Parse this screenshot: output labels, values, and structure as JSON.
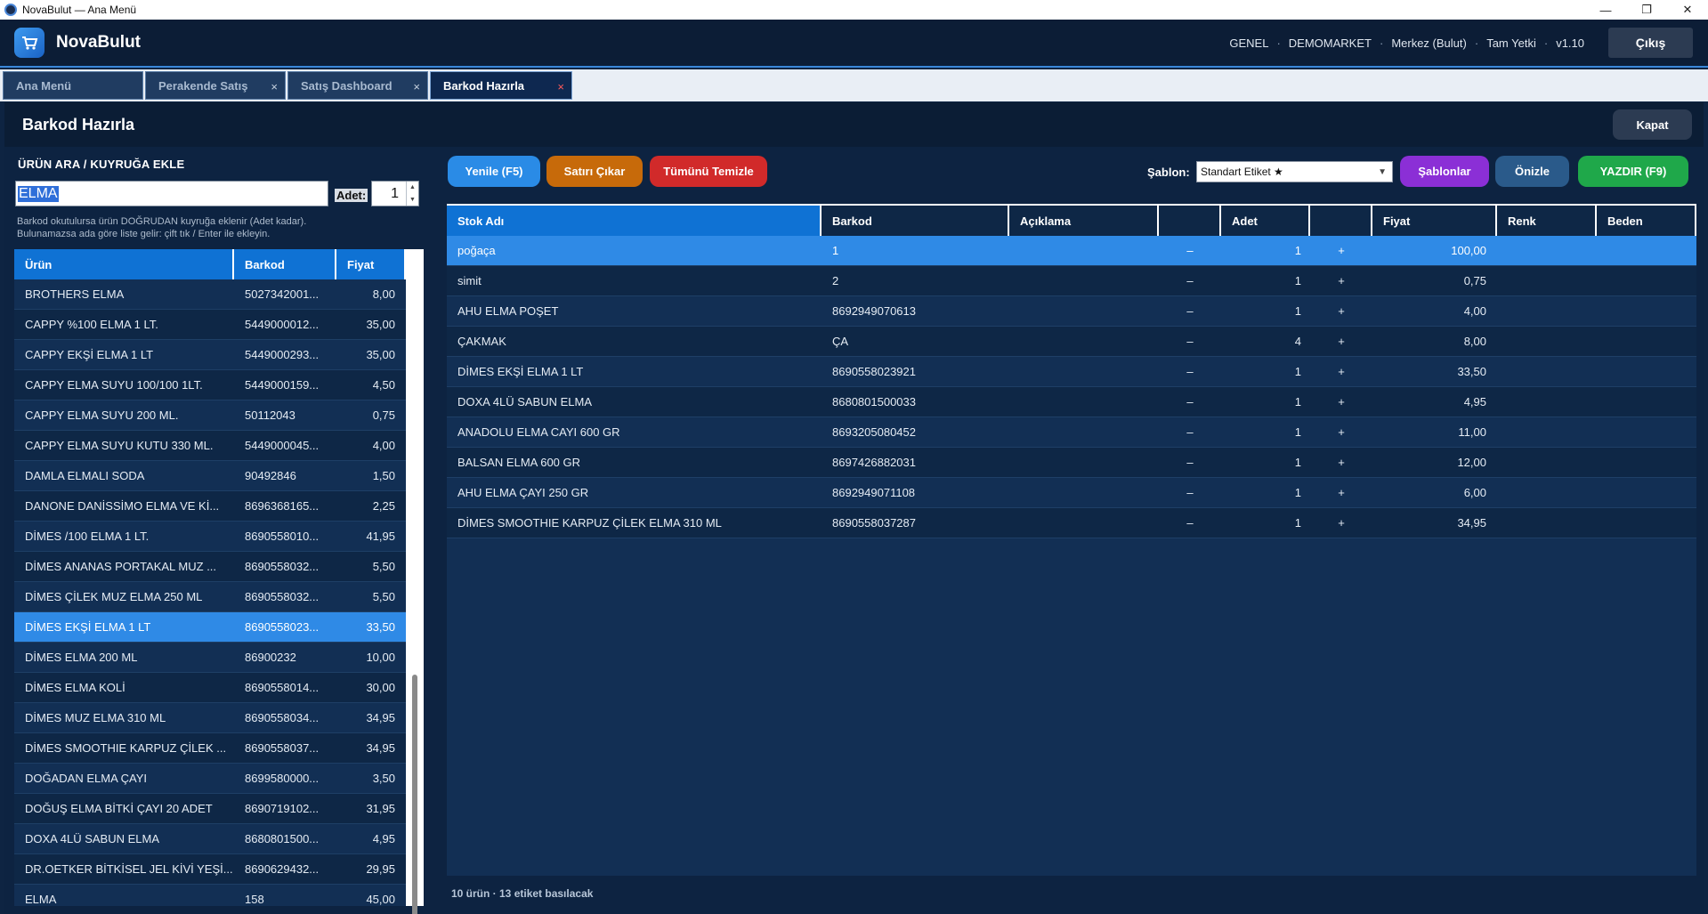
{
  "window": {
    "title": "NovaBulut — Ana Menü",
    "minimize": "—",
    "maximize": "❐",
    "close": "✕"
  },
  "header": {
    "brand": "NovaBulut",
    "info": [
      "GENEL",
      "DEMOMARKET",
      "Merkez (Bulut)",
      "Tam Yetki",
      "v1.10"
    ],
    "separator": "·",
    "logout": "Çıkış"
  },
  "tabs": [
    {
      "label": "Ana Menü",
      "closable": false
    },
    {
      "label": "Perakende Satış",
      "closable": true
    },
    {
      "label": "Satış Dashboard",
      "closable": true
    },
    {
      "label": "Barkod Hazırla",
      "closable": true,
      "active": true
    }
  ],
  "tab_close_glyph": "×",
  "page": {
    "title": "Barkod Hazırla",
    "close_button": "Kapat"
  },
  "search": {
    "heading": "ÜRÜN ARA / KUYRUĞA EKLE",
    "value": "ELMA",
    "qty_label": "Adet:",
    "qty_value": "1",
    "hint_line1": "Barkod okutulursa ürün DOĞRUDAN kuyruğa eklenir (Adet kadar).",
    "hint_line2": "Bulunamazsa ada göre liste gelir: çift tık / Enter ile ekleyin."
  },
  "product_list": {
    "columns": [
      "Ürün",
      "Barkod",
      "Fiyat"
    ],
    "selected_index": 11,
    "rows": [
      [
        "BROTHERS ELMA",
        "5027342001...",
        "8,00"
      ],
      [
        "CAPPY %100 ELMA 1 LT.",
        "5449000012...",
        "35,00"
      ],
      [
        "CAPPY EKŞİ ELMA 1 LT",
        "5449000293...",
        "35,00"
      ],
      [
        "CAPPY ELMA SUYU 100/100 1LT.",
        "5449000159...",
        "4,50"
      ],
      [
        "CAPPY ELMA SUYU 200 ML.",
        "50112043",
        "0,75"
      ],
      [
        "CAPPY ELMA SUYU KUTU 330 ML.",
        "5449000045...",
        "4,00"
      ],
      [
        "DAMLA ELMALI SODA",
        "90492846",
        "1,50"
      ],
      [
        "DANONE DANİSSİMO ELMA VE Kİ...",
        "8696368165...",
        "2,25"
      ],
      [
        "DİMES /100 ELMA 1 LT.",
        "8690558010...",
        "41,95"
      ],
      [
        "DİMES ANANAS PORTAKAL MUZ ...",
        "8690558032...",
        "5,50"
      ],
      [
        "DİMES ÇİLEK MUZ ELMA 250 ML",
        "8690558032...",
        "5,50"
      ],
      [
        "DİMES EKŞİ ELMA 1 LT",
        "8690558023...",
        "33,50"
      ],
      [
        "DİMES ELMA 200 ML",
        "86900232",
        "10,00"
      ],
      [
        "DİMES ELMA KOLİ",
        "8690558014...",
        "30,00"
      ],
      [
        "DİMES MUZ ELMA 310 ML",
        "8690558034...",
        "34,95"
      ],
      [
        "DİMES SMOOTHIE KARPUZ ÇİLEK ...",
        "8690558037...",
        "34,95"
      ],
      [
        "DOĞADAN ELMA ÇAYI",
        "8699580000...",
        "3,50"
      ],
      [
        "DOĞUŞ ELMA BİTKİ ÇAYI 20 ADET",
        "8690719102...",
        "31,95"
      ],
      [
        "DOXA 4LÜ SABUN ELMA",
        "8680801500...",
        "4,95"
      ],
      [
        "DR.OETKER BİTKİSEL JEL KİVİ YEŞİ...",
        "8690629432...",
        "29,95"
      ],
      [
        "ELMA",
        "158",
        "45,00"
      ]
    ]
  },
  "toolbar": {
    "refresh": "Yenile (F5)",
    "remove_row": "Satırı Çıkar",
    "clear_all": "Tümünü Temizle",
    "template_label": "Şablon:",
    "template_value": "Standart Etiket  ★",
    "templates": "Şablonlar",
    "preview": "Önizle",
    "print": "YAZDIR (F9)",
    "colors": {
      "refresh": "#2a8be6",
      "remove_row": "#c76a0a",
      "clear_all": "#d12a2a",
      "templates": "#8b2fd6",
      "preview": "#2a5a8a",
      "print": "#1fa84a"
    }
  },
  "queue": {
    "columns": [
      "Stok Adı",
      "Barkod",
      "Açıklama",
      "",
      "Adet",
      "",
      "Fiyat",
      "Renk",
      "Beden"
    ],
    "minus_glyph": "–",
    "plus_glyph": "+",
    "selected_index": 0,
    "rows": [
      {
        "name": "poğaça",
        "barcode": "1",
        "desc": "",
        "qty": "1",
        "price": "100,00",
        "color": "",
        "size": ""
      },
      {
        "name": "simit",
        "barcode": "2",
        "desc": "",
        "qty": "1",
        "price": "0,75",
        "color": "",
        "size": ""
      },
      {
        "name": "AHU ELMA POŞET",
        "barcode": "8692949070613",
        "desc": "",
        "qty": "1",
        "price": "4,00",
        "color": "",
        "size": ""
      },
      {
        "name": "ÇAKMAK",
        "barcode": "ÇA",
        "desc": "",
        "qty": "4",
        "price": "8,00",
        "color": "",
        "size": ""
      },
      {
        "name": "DİMES EKŞİ ELMA 1 LT",
        "barcode": "8690558023921",
        "desc": "",
        "qty": "1",
        "price": "33,50",
        "color": "",
        "size": ""
      },
      {
        "name": "DOXA 4LÜ SABUN ELMA",
        "barcode": "8680801500033",
        "desc": "",
        "qty": "1",
        "price": "4,95",
        "color": "",
        "size": ""
      },
      {
        "name": "ANADOLU ELMA CAYI 600 GR",
        "barcode": "8693205080452",
        "desc": "",
        "qty": "1",
        "price": "11,00",
        "color": "",
        "size": ""
      },
      {
        "name": "BALSAN ELMA 600 GR",
        "barcode": "8697426882031",
        "desc": "",
        "qty": "1",
        "price": "12,00",
        "color": "",
        "size": ""
      },
      {
        "name": "AHU ELMA ÇAYI 250 GR",
        "barcode": "8692949071108",
        "desc": "",
        "qty": "1",
        "price": "6,00",
        "color": "",
        "size": ""
      },
      {
        "name": "DİMES SMOOTHIE KARPUZ ÇİLEK ELMA 310 ML",
        "barcode": "8690558037287",
        "desc": "",
        "qty": "1",
        "price": "34,95",
        "color": "",
        "size": ""
      }
    ]
  },
  "status": "10 ürün · 13 etiket basılacak"
}
